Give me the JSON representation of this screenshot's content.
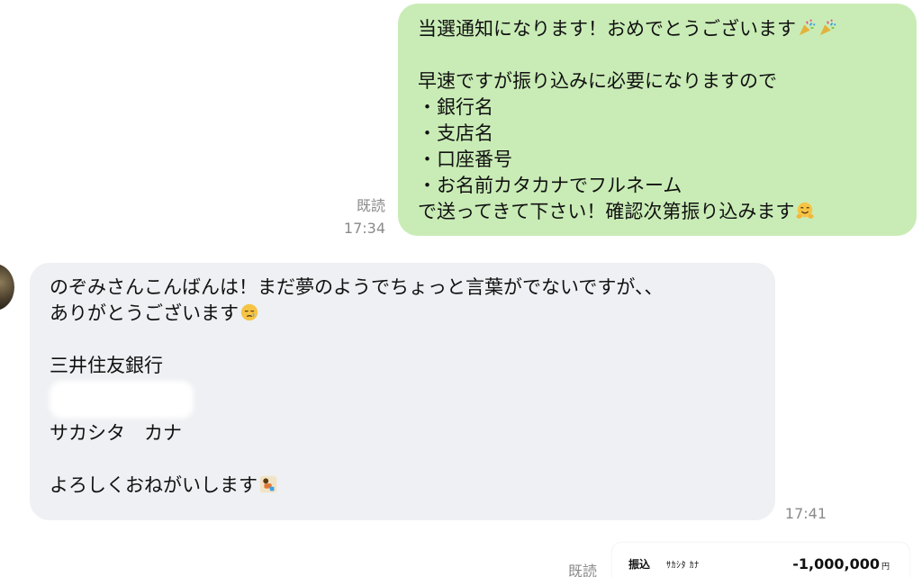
{
  "outgoing": {
    "lines": [
      "当選通知になります！おめでとうございます",
      "",
      "早速ですが振り込みに必要になりますので",
      "・銀行名",
      "・支店名",
      "・口座番号",
      "・お名前カタカナでフルネーム",
      "で送ってきて下さい！確認次第振り込みます"
    ],
    "read_label": "既読",
    "time": "17:34",
    "emojis": [
      "party-popper-icon",
      "party-popper-icon",
      "hugging-face-icon"
    ]
  },
  "incoming": {
    "lines": [
      "のぞみさんこんばんは！まだ夢のようでちょっと言葉がでないですが、、",
      "ありがとうございます",
      "",
      "三井住友銀行",
      "",
      "サカシタ　カナ",
      "",
      "よろしくおねがいします"
    ],
    "time": "17:41",
    "emojis": [
      "crying-face-icon",
      "bowing-person-icon"
    ]
  },
  "bottom": {
    "read_label": "既読",
    "transfer": {
      "type_label": "振込",
      "name": "ｻｶｼﾀ ｶﾅ",
      "amount": "-1,000,000",
      "currency": "円"
    }
  },
  "colors": {
    "outgoing_bubble": "#c9ecb6",
    "incoming_bubble": "#eef0f3",
    "meta_text": "#8a8a8a"
  }
}
